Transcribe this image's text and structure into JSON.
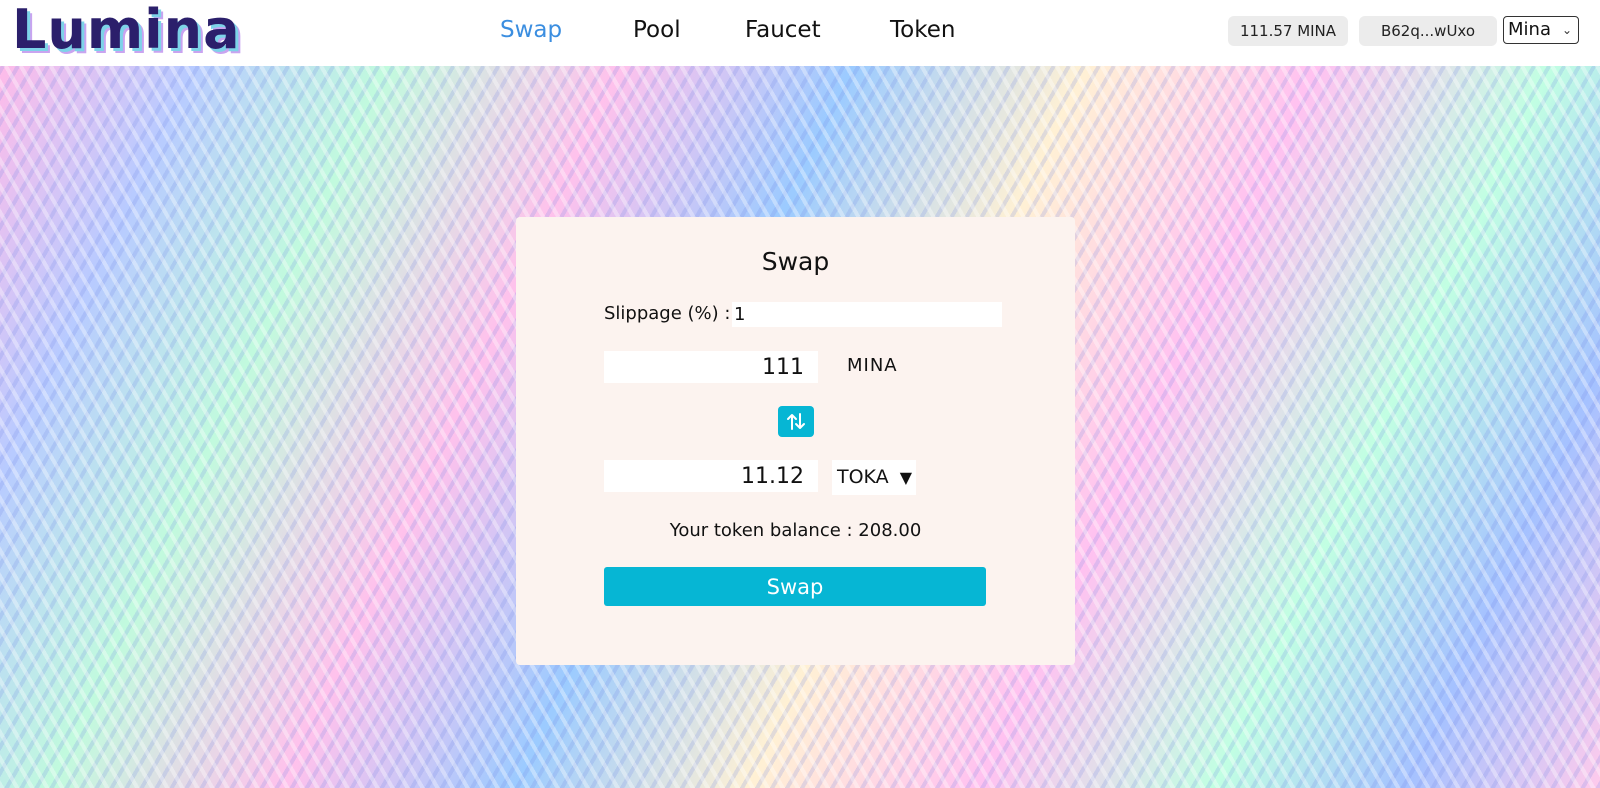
{
  "header": {
    "logo": "Lumina",
    "nav": {
      "swap": "Swap",
      "pool": "Pool",
      "faucet": "Faucet",
      "token": "Token"
    },
    "balance": "111.57 MINA",
    "address": "B62q...wUxo",
    "network": "Mina"
  },
  "swap_card": {
    "title": "Swap",
    "slippage_label": "Slippage (%) :",
    "slippage_value": "1",
    "from_amount": "111",
    "from_token": "MINA",
    "switch_icon": "swap-vertical-arrows-icon",
    "to_amount": "11.12",
    "to_token": "TOKA",
    "to_token_caret": "▼",
    "token_balance": "Your token balance : 208.00",
    "swap_button": "Swap"
  },
  "colors": {
    "accent": "#06b6d4",
    "active_nav": "#3b8ee0",
    "card_bg": "#fcf3ef",
    "logo": "#2b1f6b"
  }
}
